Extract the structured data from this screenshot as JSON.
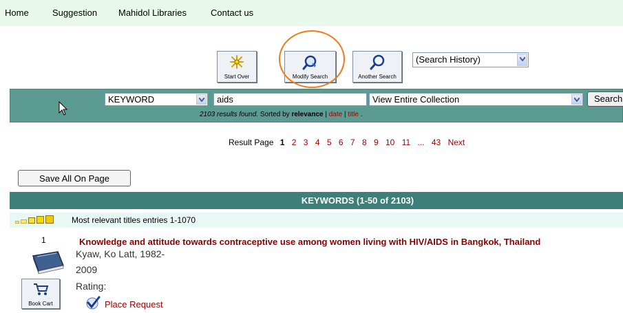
{
  "nav": {
    "items": [
      "Home",
      "Suggestion",
      "Mahidol Libraries",
      "Contact us"
    ]
  },
  "toolbar": {
    "start_over": "Start Over",
    "modify_search": "Modify Search",
    "another_search": "Another Search",
    "history_select": "(Search History)"
  },
  "search": {
    "field_select": "KEYWORD",
    "query": "aids",
    "scope_select": "View Entire Collection",
    "button": "Search",
    "results_found": "2103 results found.",
    "sorted_by": "Sorted by",
    "sort_relevance": "relevance",
    "sort_date": "date",
    "sort_title": "title"
  },
  "pager": {
    "label": "Result Page",
    "current": "1",
    "pages": [
      "2",
      "3",
      "4",
      "5",
      "6",
      "7",
      "8",
      "9",
      "10",
      "11"
    ],
    "ellipsis": "...",
    "last": "43",
    "next": "Next"
  },
  "save_all": "Save All On Page",
  "keywords_header": "KEYWORDS (1-50 of 2103)",
  "relevance_text": "Most relevant titles entries 1-1070",
  "record": {
    "number": "1",
    "title": "Knowledge and attitude towards contraceptive use among women living with HIV/AIDS in Bangkok, Thailand",
    "author": "Kyaw, Ko Latt, 1982-",
    "year": "2009",
    "rating": "Rating:",
    "book_cart": "Book Cart",
    "place_request": "Place Request"
  },
  "colors": {
    "nav_bg": "#e8f8ea",
    "searchbar_bg": "#5b9b92",
    "header_bg": "#3f7f79",
    "link": "#a30000",
    "title": "#8b0000",
    "highlight_ring": "#f07a1a"
  }
}
